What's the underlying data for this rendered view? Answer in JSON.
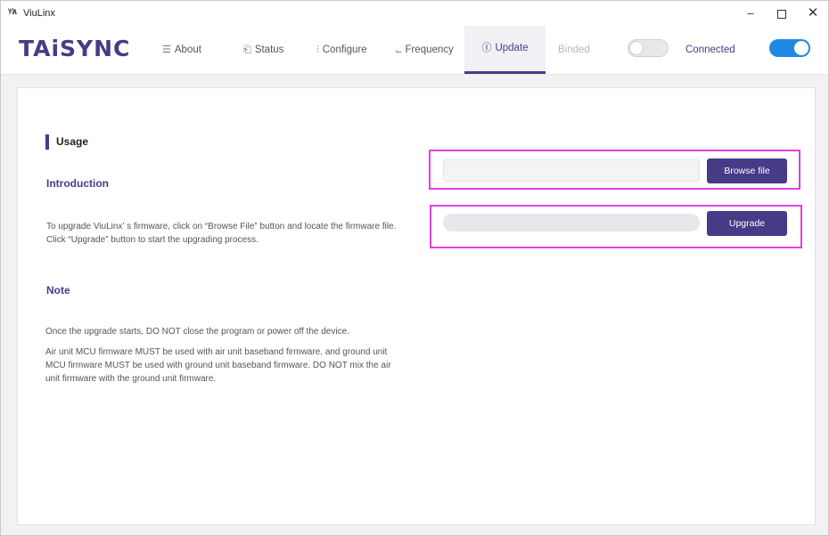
{
  "window": {
    "title": "ViuLinx",
    "icon_glyph": "ᵛ⁄∧",
    "controls": {
      "minimize": "–",
      "close": "✕"
    }
  },
  "nav": {
    "logo": "TAiSYNC",
    "tabs": [
      {
        "label": "About",
        "icon": "about-icon",
        "glyph": "☰"
      },
      {
        "label": "Status",
        "icon": "status-icon",
        "glyph": "⎗"
      },
      {
        "label": "Configure",
        "icon": "configure-icon",
        "glyph": "⫶"
      },
      {
        "label": "Frequency",
        "icon": "frequency-icon",
        "glyph": "⨽"
      },
      {
        "label": "Update",
        "icon": "update-icon",
        "glyph": "Ⓘ"
      }
    ],
    "active_tab": "Update",
    "binded": {
      "label": "Binded",
      "on": false
    },
    "connected": {
      "label": "Connected",
      "on": true
    }
  },
  "usage": {
    "heading": "Usage",
    "intro_heading": "Introduction",
    "intro_text": "To upgrade ViuLinx’ s firmware, click on “Browse File” button and locate the firmware file. Click “Upgrade” button to start the upgrading process.",
    "note_heading": "Note",
    "note_p1": "Once the upgrade starts, DO NOT close the program or power off the device.",
    "note_p2": "Air unit MCU firmware MUST be used with air unit baseband firmware, and ground unit MCU firmware MUST be used with ground unit baseband firmware. DO NOT mix the air unit firmware with the ground unit firmware."
  },
  "firmware": {
    "file_path_value": "",
    "browse_label": "Browse file",
    "upgrade_label": "Upgrade",
    "progress_fraction": 0
  },
  "colors": {
    "accent": "#473a86",
    "toggle_on": "#1e88e5",
    "highlight": "#e040e0"
  }
}
